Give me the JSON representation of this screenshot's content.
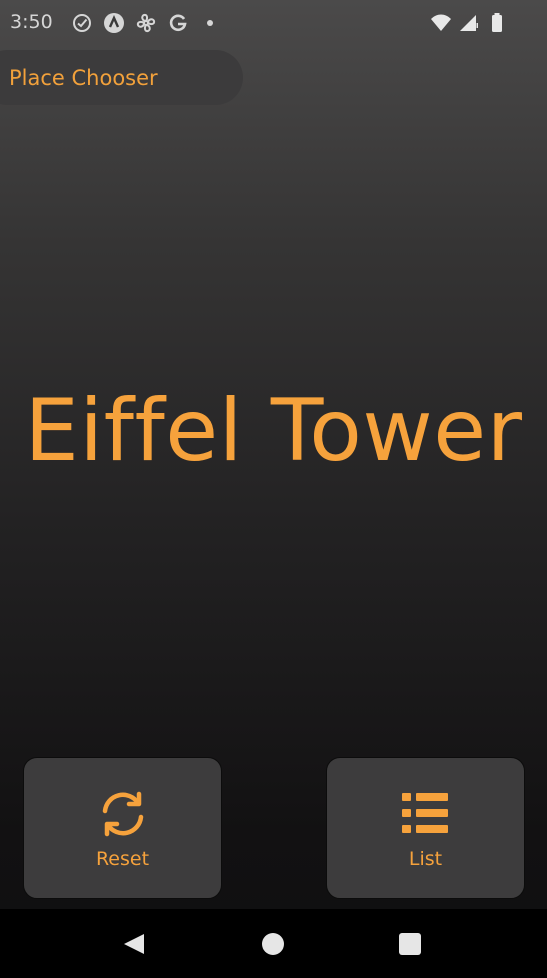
{
  "status_bar": {
    "time": "3:50",
    "left_icons": [
      "check-circle-icon",
      "android-auto-icon",
      "fan-icon",
      "google-icon",
      "dot-icon"
    ],
    "right_icons": [
      "wifi-icon",
      "signal-icon",
      "battery-icon"
    ]
  },
  "app_bar": {
    "title": "Place Chooser"
  },
  "main": {
    "place_name": "Eiffel Tower"
  },
  "buttons": {
    "reset_label": "Reset",
    "list_label": "List"
  },
  "nav_bar": {
    "icons": [
      "back-icon",
      "home-icon",
      "recents-icon"
    ]
  },
  "colors": {
    "accent": "#f6a23c",
    "button_bg": "#3d3c3d",
    "pill_bg": "#3c3b3c"
  }
}
